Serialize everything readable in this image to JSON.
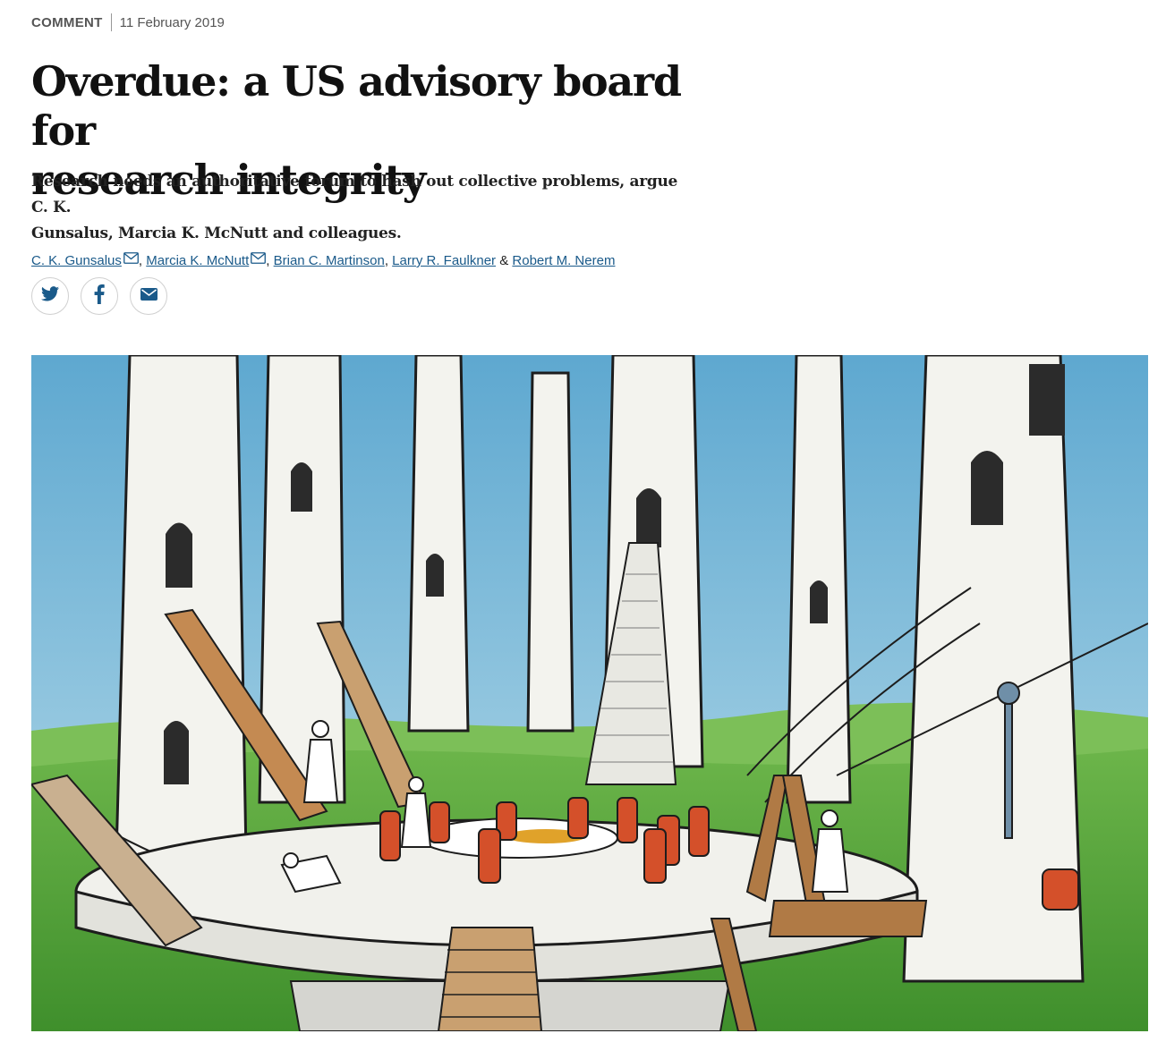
{
  "article": {
    "type": "COMMENT",
    "date": "11 February 2019",
    "title_line1": "Overdue: a US advisory board for",
    "title_line2": "research integrity",
    "standfirst_line1": "Research needs an authoritative forum to hash out collective problems, argue C. K.",
    "standfirst_line2": "Gunsalus, Marcia K. McNutt and colleagues."
  },
  "authors": [
    {
      "name": "C. K. Gunsalus",
      "email_icon": "mail-icon"
    },
    {
      "name": "Marcia K. McNutt",
      "email_icon": "mail-icon"
    },
    {
      "name": "Brian C. Martinson"
    },
    {
      "name": "Larry R. Faulkner"
    },
    {
      "name": "Robert M. Nerem"
    }
  ],
  "author_separators": [
    ",",
    ",",
    ",",
    "&"
  ],
  "share": {
    "icons": [
      "twitter-icon",
      "facebook-icon",
      "email-icon"
    ],
    "icon_color": "#1a5a8a"
  },
  "hero_image": {
    "description_icon": "illustration",
    "colors": {
      "sky": "#6fb3d6",
      "grass": "#4f9e35",
      "tower": "#f2f2ee",
      "chair": "#d4502a",
      "wood": "#b07a45"
    }
  }
}
